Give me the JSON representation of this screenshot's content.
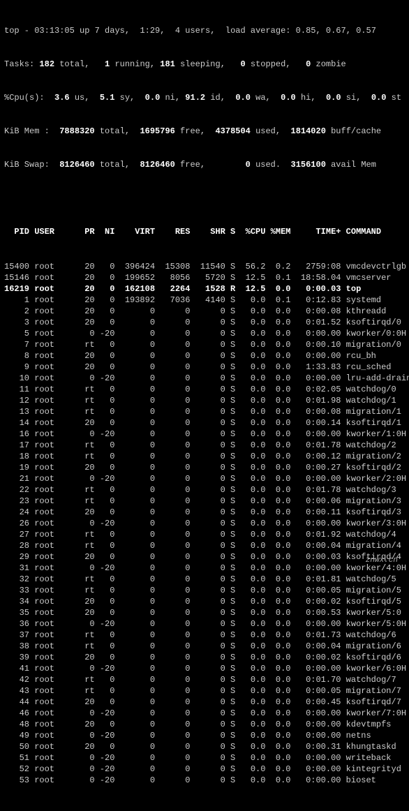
{
  "summary": {
    "line1_pre": "top - ",
    "time": "03:13:05",
    "uptime": " up 7 days,  1:29,  4 users,  load average: 0.85, 0.67, 0.57",
    "tasks_label": "Tasks:",
    "tasks_total": " 182 ",
    "tasks_total_lbl": "total,   ",
    "tasks_running": "1 ",
    "tasks_running_lbl": "running, ",
    "tasks_sleeping": "181 ",
    "tasks_sleeping_lbl": "sleeping,   ",
    "tasks_stopped": "0 ",
    "tasks_stopped_lbl": "stopped,   ",
    "tasks_zombie": "0 ",
    "tasks_zombie_lbl": "zombie",
    "cpu_label": "%Cpu(s):  ",
    "cpu_us": "3.6 ",
    "cpu_us_lbl": "us,  ",
    "cpu_sy": "5.1 ",
    "cpu_sy_lbl": "sy,  ",
    "cpu_ni": "0.0 ",
    "cpu_ni_lbl": "ni, ",
    "cpu_id": "91.2 ",
    "cpu_id_lbl": "id,  ",
    "cpu_wa": "0.0 ",
    "cpu_wa_lbl": "wa,  ",
    "cpu_hi": "0.0 ",
    "cpu_hi_lbl": "hi,  ",
    "cpu_si": "0.0 ",
    "cpu_si_lbl": "si,  ",
    "cpu_st": "0.0 ",
    "cpu_st_lbl": "st",
    "mem_label": "KiB Mem : ",
    "mem_total": " 7888320 ",
    "mem_total_lbl": "total,  ",
    "mem_free": "1695796 ",
    "mem_free_lbl": "free,  ",
    "mem_used": "4378504 ",
    "mem_used_lbl": "used,  ",
    "mem_buff": "1814020 ",
    "mem_buff_lbl": "buff/cache",
    "swap_label": "KiB Swap: ",
    "swap_total": " 8126460 ",
    "swap_total_lbl": "total,  ",
    "swap_free": "8126460 ",
    "swap_free_lbl": "free,        ",
    "swap_used": "0 ",
    "swap_used_lbl": "used.  ",
    "swap_avail": "3156100 ",
    "swap_avail_lbl": "avail Mem"
  },
  "columns": "  PID USER      PR  NI    VIRT    RES    SHR S  %CPU %MEM     TIME+ COMMAND    ",
  "rows": [
    {
      "pid": "15400",
      "user": "root",
      "pr": "20",
      "ni": "0",
      "virt": "396424",
      "res": "15308",
      "shr": "11540",
      "s": "S",
      "cpu": "56.2",
      "mem": "0.2",
      "time": "2759:08",
      "cmd": "vmcdevctrlgb",
      "bold": false
    },
    {
      "pid": "15146",
      "user": "root",
      "pr": "20",
      "ni": "0",
      "virt": "199652",
      "res": "8056",
      "shr": "5720",
      "s": "S",
      "cpu": "12.5",
      "mem": "0.1",
      "time": "18:58.04",
      "cmd": "vmcserver",
      "bold": false
    },
    {
      "pid": "16219",
      "user": "root",
      "pr": "20",
      "ni": "0",
      "virt": "162108",
      "res": "2264",
      "shr": "1528",
      "s": "R",
      "cpu": "12.5",
      "mem": "0.0",
      "time": "0:00.03",
      "cmd": "top",
      "bold": true
    },
    {
      "pid": "1",
      "user": "root",
      "pr": "20",
      "ni": "0",
      "virt": "193892",
      "res": "7036",
      "shr": "4140",
      "s": "S",
      "cpu": "0.0",
      "mem": "0.1",
      "time": "0:12.83",
      "cmd": "systemd",
      "bold": false
    },
    {
      "pid": "2",
      "user": "root",
      "pr": "20",
      "ni": "0",
      "virt": "0",
      "res": "0",
      "shr": "0",
      "s": "S",
      "cpu": "0.0",
      "mem": "0.0",
      "time": "0:00.08",
      "cmd": "kthreadd",
      "bold": false
    },
    {
      "pid": "3",
      "user": "root",
      "pr": "20",
      "ni": "0",
      "virt": "0",
      "res": "0",
      "shr": "0",
      "s": "S",
      "cpu": "0.0",
      "mem": "0.0",
      "time": "0:01.52",
      "cmd": "ksoftirqd/0",
      "bold": false
    },
    {
      "pid": "5",
      "user": "root",
      "pr": "0",
      "ni": "-20",
      "virt": "0",
      "res": "0",
      "shr": "0",
      "s": "S",
      "cpu": "0.0",
      "mem": "0.0",
      "time": "0:00.00",
      "cmd": "kworker/0:0H",
      "bold": false
    },
    {
      "pid": "7",
      "user": "root",
      "pr": "rt",
      "ni": "0",
      "virt": "0",
      "res": "0",
      "shr": "0",
      "s": "S",
      "cpu": "0.0",
      "mem": "0.0",
      "time": "0:00.10",
      "cmd": "migration/0",
      "bold": false
    },
    {
      "pid": "8",
      "user": "root",
      "pr": "20",
      "ni": "0",
      "virt": "0",
      "res": "0",
      "shr": "0",
      "s": "S",
      "cpu": "0.0",
      "mem": "0.0",
      "time": "0:00.00",
      "cmd": "rcu_bh",
      "bold": false
    },
    {
      "pid": "9",
      "user": "root",
      "pr": "20",
      "ni": "0",
      "virt": "0",
      "res": "0",
      "shr": "0",
      "s": "S",
      "cpu": "0.0",
      "mem": "0.0",
      "time": "1:33.83",
      "cmd": "rcu_sched",
      "bold": false
    },
    {
      "pid": "10",
      "user": "root",
      "pr": "0",
      "ni": "-20",
      "virt": "0",
      "res": "0",
      "shr": "0",
      "s": "S",
      "cpu": "0.0",
      "mem": "0.0",
      "time": "0:00.00",
      "cmd": "lru-add-drain",
      "bold": false
    },
    {
      "pid": "11",
      "user": "root",
      "pr": "rt",
      "ni": "0",
      "virt": "0",
      "res": "0",
      "shr": "0",
      "s": "S",
      "cpu": "0.0",
      "mem": "0.0",
      "time": "0:02.05",
      "cmd": "watchdog/0",
      "bold": false
    },
    {
      "pid": "12",
      "user": "root",
      "pr": "rt",
      "ni": "0",
      "virt": "0",
      "res": "0",
      "shr": "0",
      "s": "S",
      "cpu": "0.0",
      "mem": "0.0",
      "time": "0:01.98",
      "cmd": "watchdog/1",
      "bold": false
    },
    {
      "pid": "13",
      "user": "root",
      "pr": "rt",
      "ni": "0",
      "virt": "0",
      "res": "0",
      "shr": "0",
      "s": "S",
      "cpu": "0.0",
      "mem": "0.0",
      "time": "0:00.08",
      "cmd": "migration/1",
      "bold": false
    },
    {
      "pid": "14",
      "user": "root",
      "pr": "20",
      "ni": "0",
      "virt": "0",
      "res": "0",
      "shr": "0",
      "s": "S",
      "cpu": "0.0",
      "mem": "0.0",
      "time": "0:00.14",
      "cmd": "ksoftirqd/1",
      "bold": false
    },
    {
      "pid": "16",
      "user": "root",
      "pr": "0",
      "ni": "-20",
      "virt": "0",
      "res": "0",
      "shr": "0",
      "s": "S",
      "cpu": "0.0",
      "mem": "0.0",
      "time": "0:00.00",
      "cmd": "kworker/1:0H",
      "bold": false
    },
    {
      "pid": "17",
      "user": "root",
      "pr": "rt",
      "ni": "0",
      "virt": "0",
      "res": "0",
      "shr": "0",
      "s": "S",
      "cpu": "0.0",
      "mem": "0.0",
      "time": "0:01.78",
      "cmd": "watchdog/2",
      "bold": false
    },
    {
      "pid": "18",
      "user": "root",
      "pr": "rt",
      "ni": "0",
      "virt": "0",
      "res": "0",
      "shr": "0",
      "s": "S",
      "cpu": "0.0",
      "mem": "0.0",
      "time": "0:00.12",
      "cmd": "migration/2",
      "bold": false
    },
    {
      "pid": "19",
      "user": "root",
      "pr": "20",
      "ni": "0",
      "virt": "0",
      "res": "0",
      "shr": "0",
      "s": "S",
      "cpu": "0.0",
      "mem": "0.0",
      "time": "0:00.27",
      "cmd": "ksoftirqd/2",
      "bold": false
    },
    {
      "pid": "21",
      "user": "root",
      "pr": "0",
      "ni": "-20",
      "virt": "0",
      "res": "0",
      "shr": "0",
      "s": "S",
      "cpu": "0.0",
      "mem": "0.0",
      "time": "0:00.00",
      "cmd": "kworker/2:0H",
      "bold": false
    },
    {
      "pid": "22",
      "user": "root",
      "pr": "rt",
      "ni": "0",
      "virt": "0",
      "res": "0",
      "shr": "0",
      "s": "S",
      "cpu": "0.0",
      "mem": "0.0",
      "time": "0:01.78",
      "cmd": "watchdog/3",
      "bold": false
    },
    {
      "pid": "23",
      "user": "root",
      "pr": "rt",
      "ni": "0",
      "virt": "0",
      "res": "0",
      "shr": "0",
      "s": "S",
      "cpu": "0.0",
      "mem": "0.0",
      "time": "0:00.06",
      "cmd": "migration/3",
      "bold": false
    },
    {
      "pid": "24",
      "user": "root",
      "pr": "20",
      "ni": "0",
      "virt": "0",
      "res": "0",
      "shr": "0",
      "s": "S",
      "cpu": "0.0",
      "mem": "0.0",
      "time": "0:00.11",
      "cmd": "ksoftirqd/3",
      "bold": false
    },
    {
      "pid": "26",
      "user": "root",
      "pr": "0",
      "ni": "-20",
      "virt": "0",
      "res": "0",
      "shr": "0",
      "s": "S",
      "cpu": "0.0",
      "mem": "0.0",
      "time": "0:00.00",
      "cmd": "kworker/3:0H",
      "bold": false
    },
    {
      "pid": "27",
      "user": "root",
      "pr": "rt",
      "ni": "0",
      "virt": "0",
      "res": "0",
      "shr": "0",
      "s": "S",
      "cpu": "0.0",
      "mem": "0.0",
      "time": "0:01.92",
      "cmd": "watchdog/4",
      "bold": false
    },
    {
      "pid": "28",
      "user": "root",
      "pr": "rt",
      "ni": "0",
      "virt": "0",
      "res": "0",
      "shr": "0",
      "s": "S",
      "cpu": "0.0",
      "mem": "0.0",
      "time": "0:00.04",
      "cmd": "migration/4",
      "bold": false
    },
    {
      "pid": "29",
      "user": "root",
      "pr": "20",
      "ni": "0",
      "virt": "0",
      "res": "0",
      "shr": "0",
      "s": "S",
      "cpu": "0.0",
      "mem": "0.0",
      "time": "0:00.03",
      "cmd": "ksoftirqd/4",
      "bold": false
    },
    {
      "pid": "31",
      "user": "root",
      "pr": "0",
      "ni": "-20",
      "virt": "0",
      "res": "0",
      "shr": "0",
      "s": "S",
      "cpu": "0.0",
      "mem": "0.0",
      "time": "0:00.00",
      "cmd": "kworker/4:0H",
      "bold": false
    },
    {
      "pid": "32",
      "user": "root",
      "pr": "rt",
      "ni": "0",
      "virt": "0",
      "res": "0",
      "shr": "0",
      "s": "S",
      "cpu": "0.0",
      "mem": "0.0",
      "time": "0:01.81",
      "cmd": "watchdog/5",
      "bold": false
    },
    {
      "pid": "33",
      "user": "root",
      "pr": "rt",
      "ni": "0",
      "virt": "0",
      "res": "0",
      "shr": "0",
      "s": "S",
      "cpu": "0.0",
      "mem": "0.0",
      "time": "0:00.05",
      "cmd": "migration/5",
      "bold": false
    },
    {
      "pid": "34",
      "user": "root",
      "pr": "20",
      "ni": "0",
      "virt": "0",
      "res": "0",
      "shr": "0",
      "s": "S",
      "cpu": "0.0",
      "mem": "0.0",
      "time": "0:00.02",
      "cmd": "ksoftirqd/5",
      "bold": false
    },
    {
      "pid": "35",
      "user": "root",
      "pr": "20",
      "ni": "0",
      "virt": "0",
      "res": "0",
      "shr": "0",
      "s": "S",
      "cpu": "0.0",
      "mem": "0.0",
      "time": "0:00.53",
      "cmd": "kworker/5:0",
      "bold": false
    },
    {
      "pid": "36",
      "user": "root",
      "pr": "0",
      "ni": "-20",
      "virt": "0",
      "res": "0",
      "shr": "0",
      "s": "S",
      "cpu": "0.0",
      "mem": "0.0",
      "time": "0:00.00",
      "cmd": "kworker/5:0H",
      "bold": false
    },
    {
      "pid": "37",
      "user": "root",
      "pr": "rt",
      "ni": "0",
      "virt": "0",
      "res": "0",
      "shr": "0",
      "s": "S",
      "cpu": "0.0",
      "mem": "0.0",
      "time": "0:01.73",
      "cmd": "watchdog/6",
      "bold": false
    },
    {
      "pid": "38",
      "user": "root",
      "pr": "rt",
      "ni": "0",
      "virt": "0",
      "res": "0",
      "shr": "0",
      "s": "S",
      "cpu": "0.0",
      "mem": "0.0",
      "time": "0:00.04",
      "cmd": "migration/6",
      "bold": false
    },
    {
      "pid": "39",
      "user": "root",
      "pr": "20",
      "ni": "0",
      "virt": "0",
      "res": "0",
      "shr": "0",
      "s": "S",
      "cpu": "0.0",
      "mem": "0.0",
      "time": "0:00.02",
      "cmd": "ksoftirqd/6",
      "bold": false
    },
    {
      "pid": "41",
      "user": "root",
      "pr": "0",
      "ni": "-20",
      "virt": "0",
      "res": "0",
      "shr": "0",
      "s": "S",
      "cpu": "0.0",
      "mem": "0.0",
      "time": "0:00.00",
      "cmd": "kworker/6:0H",
      "bold": false
    },
    {
      "pid": "42",
      "user": "root",
      "pr": "rt",
      "ni": "0",
      "virt": "0",
      "res": "0",
      "shr": "0",
      "s": "S",
      "cpu": "0.0",
      "mem": "0.0",
      "time": "0:01.70",
      "cmd": "watchdog/7",
      "bold": false
    },
    {
      "pid": "43",
      "user": "root",
      "pr": "rt",
      "ni": "0",
      "virt": "0",
      "res": "0",
      "shr": "0",
      "s": "S",
      "cpu": "0.0",
      "mem": "0.0",
      "time": "0:00.05",
      "cmd": "migration/7",
      "bold": false
    },
    {
      "pid": "44",
      "user": "root",
      "pr": "20",
      "ni": "0",
      "virt": "0",
      "res": "0",
      "shr": "0",
      "s": "S",
      "cpu": "0.0",
      "mem": "0.0",
      "time": "0:00.45",
      "cmd": "ksoftirqd/7",
      "bold": false
    },
    {
      "pid": "46",
      "user": "root",
      "pr": "0",
      "ni": "-20",
      "virt": "0",
      "res": "0",
      "shr": "0",
      "s": "S",
      "cpu": "0.0",
      "mem": "0.0",
      "time": "0:00.00",
      "cmd": "kworker/7:0H",
      "bold": false
    },
    {
      "pid": "48",
      "user": "root",
      "pr": "20",
      "ni": "0",
      "virt": "0",
      "res": "0",
      "shr": "0",
      "s": "S",
      "cpu": "0.0",
      "mem": "0.0",
      "time": "0:00.00",
      "cmd": "kdevtmpfs",
      "bold": false
    },
    {
      "pid": "49",
      "user": "root",
      "pr": "0",
      "ni": "-20",
      "virt": "0",
      "res": "0",
      "shr": "0",
      "s": "S",
      "cpu": "0.0",
      "mem": "0.0",
      "time": "0:00.00",
      "cmd": "netns",
      "bold": false
    },
    {
      "pid": "50",
      "user": "root",
      "pr": "20",
      "ni": "0",
      "virt": "0",
      "res": "0",
      "shr": "0",
      "s": "S",
      "cpu": "0.0",
      "mem": "0.0",
      "time": "0:00.31",
      "cmd": "khungtaskd",
      "bold": false
    },
    {
      "pid": "51",
      "user": "root",
      "pr": "0",
      "ni": "-20",
      "virt": "0",
      "res": "0",
      "shr": "0",
      "s": "S",
      "cpu": "0.0",
      "mem": "0.0",
      "time": "0:00.00",
      "cmd": "writeback",
      "bold": false
    },
    {
      "pid": "52",
      "user": "root",
      "pr": "0",
      "ni": "-20",
      "virt": "0",
      "res": "0",
      "shr": "0",
      "s": "S",
      "cpu": "0.0",
      "mem": "0.0",
      "time": "0:00.00",
      "cmd": "kintegrityd",
      "bold": false
    },
    {
      "pid": "53",
      "user": "root",
      "pr": "0",
      "ni": "-20",
      "virt": "0",
      "res": "0",
      "shr": "0",
      "s": "S",
      "cpu": "0.0",
      "mem": "0.0",
      "time": "0:00.00",
      "cmd": "bioset",
      "bold": false
    }
  ],
  "watermark": "znwx.cn"
}
